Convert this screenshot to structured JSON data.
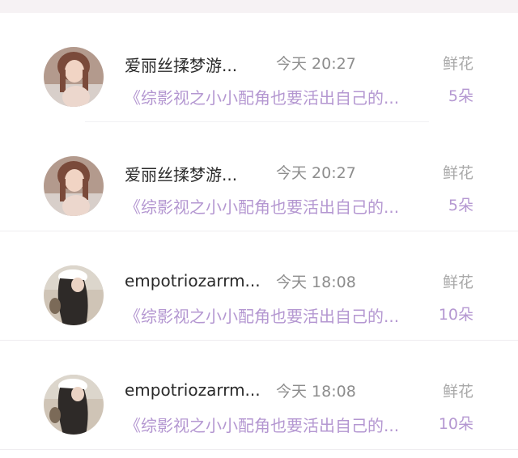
{
  "rows": [
    {
      "name": "爱丽丝揉梦游...",
      "time": "今天 20:27",
      "label": "鲜花",
      "book": "《综影视之小小配角也要活出自己的...",
      "count": "5朵",
      "avatar": "avatar-girl-icon"
    },
    {
      "name": "爱丽丝揉梦游...",
      "time": "今天 20:27",
      "label": "鲜花",
      "book": "《综影视之小小配角也要活出自己的...",
      "count": "5朵",
      "avatar": "avatar-girl-icon"
    },
    {
      "name": "empotriozarrm...",
      "time": "今天 18:08",
      "label": "鲜花",
      "book": "《综影视之小小配角也要活出自己的...",
      "count": "10朵",
      "avatar": "avatar-woman-cap-icon"
    },
    {
      "name": "empotriozarrm...",
      "time": "今天 18:08",
      "label": "鲜花",
      "book": "《综影视之小小配角也要活出自己的...",
      "count": "10朵",
      "avatar": "avatar-woman-cap-icon"
    }
  ],
  "colors": {
    "accent": "#b497d1",
    "name": "#2a2a2a",
    "muted": "#8d8d8d"
  }
}
